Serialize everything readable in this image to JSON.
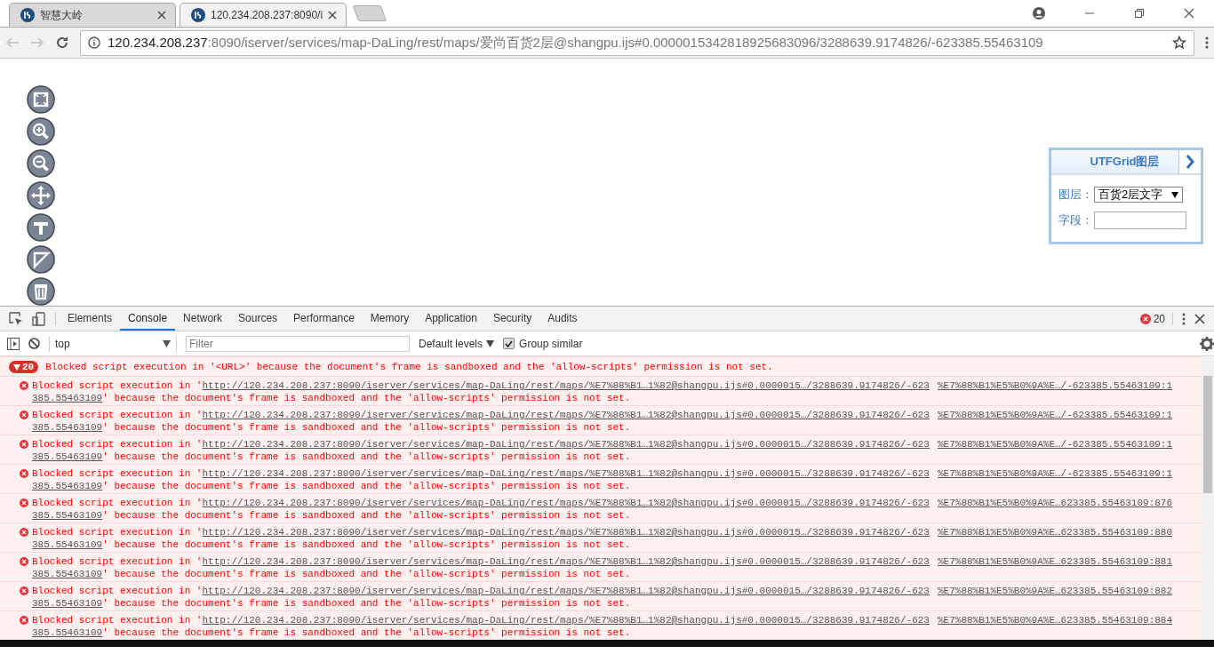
{
  "browser": {
    "tabs": [
      {
        "title": "智慧大岭",
        "selected": false
      },
      {
        "title": "120.234.208.237:8090/i",
        "selected": true
      }
    ],
    "address": {
      "host": "120.234.208.237",
      "path": ":8090/iserver/services/map-DaLing/rest/maps/爱尚百货2层@shangpu.ijs#0.0000015342818925683096/3288639.9174826/-623385.55463109"
    }
  },
  "utfgrid_panel": {
    "title": "UTFGrid图层",
    "fields": [
      {
        "kind": "select",
        "label": "图层：",
        "value": "百货2层文字"
      },
      {
        "kind": "input",
        "label": "字段："
      }
    ]
  },
  "devtools": {
    "tabs": [
      {
        "label": "Elements",
        "selected": false
      },
      {
        "label": "Console",
        "selected": true
      },
      {
        "label": "Network",
        "selected": false
      },
      {
        "label": "Sources",
        "selected": false
      },
      {
        "label": "Performance",
        "selected": false
      },
      {
        "label": "Memory",
        "selected": false
      },
      {
        "label": "Application",
        "selected": false
      },
      {
        "label": "Security",
        "selected": false
      },
      {
        "label": "Audits",
        "selected": false
      }
    ],
    "error_count": "20",
    "context": "top",
    "filter_placeholder": "Filter",
    "levels": "Default levels",
    "group_similar": {
      "label": "Group similar",
      "checked": true
    },
    "group": {
      "count": "20",
      "message": "Blocked script execution in '<URL>' because the document's frame is sandboxed and the 'allow-scripts' permission is not set."
    },
    "messages": [
      {
        "prefix": "Blocked script execution in '",
        "url_line1": "http://120.234.208.237:8090/iserver/services/map-DaLing/rest/maps/%E7%88%B1…1%82@shangpu.ijs#0.0000015…/3288639.9174826/-623",
        "url_line2": "385.55463109",
        "suffix": "' because the document's frame is sandboxed and the 'allow-scripts' permission is not set.",
        "source": "%E7%88%B1%E5%B0%9A%E…/-623385.55463109:1"
      },
      {
        "prefix": "Blocked script execution in '",
        "url_line1": "http://120.234.208.237:8090/iserver/services/map-DaLing/rest/maps/%E7%88%B1…1%82@shangpu.ijs#0.0000015…/3288639.9174826/-623",
        "url_line2": "385.55463109",
        "suffix": "' because the document's frame is sandboxed and the 'allow-scripts' permission is not set.",
        "source": "%E7%88%B1%E5%B0%9A%E…/-623385.55463109:1"
      },
      {
        "prefix": "Blocked script execution in '",
        "url_line1": "http://120.234.208.237:8090/iserver/services/map-DaLing/rest/maps/%E7%88%B1…1%82@shangpu.ijs#0.0000015…/3288639.9174826/-623",
        "url_line2": "385.55463109",
        "suffix": "' because the document's frame is sandboxed and the 'allow-scripts' permission is not set.",
        "source": "%E7%88%B1%E5%B0%9A%E…/-623385.55463109:1"
      },
      {
        "prefix": "Blocked script execution in '",
        "url_line1": "http://120.234.208.237:8090/iserver/services/map-DaLing/rest/maps/%E7%88%B1…1%82@shangpu.ijs#0.0000015…/3288639.9174826/-623",
        "url_line2": "385.55463109",
        "suffix": "' because the document's frame is sandboxed and the 'allow-scripts' permission is not set.",
        "source": "%E7%88%B1%E5%B0%9A%E…/-623385.55463109:1"
      },
      {
        "prefix": "Blocked script execution in '",
        "url_line1": "http://120.234.208.237:8090/iserver/services/map-DaLing/rest/maps/%E7%88%B1…1%82@shangpu.ijs#0.0000015…/3288639.9174826/-623",
        "url_line2": "385.55463109",
        "suffix": "' because the document's frame is sandboxed and the 'allow-scripts' permission is not set.",
        "source": "%E7%88%B1%E5%B0%9A%E…623385.55463109:876"
      },
      {
        "prefix": "Blocked script execution in '",
        "url_line1": "http://120.234.208.237:8090/iserver/services/map-DaLing/rest/maps/%E7%88%B1…1%82@shangpu.ijs#0.0000015…/3288639.9174826/-623",
        "url_line2": "385.55463109",
        "suffix": "' because the document's frame is sandboxed and the 'allow-scripts' permission is not set.",
        "source": "%E7%88%B1%E5%B0%9A%E…623385.55463109:880"
      },
      {
        "prefix": "Blocked script execution in '",
        "url_line1": "http://120.234.208.237:8090/iserver/services/map-DaLing/rest/maps/%E7%88%B1…1%82@shangpu.ijs#0.0000015…/3288639.9174826/-623",
        "url_line2": "385.55463109",
        "suffix": "' because the document's frame is sandboxed and the 'allow-scripts' permission is not set.",
        "source": "%E7%88%B1%E5%B0%9A%E…623385.55463109:881"
      },
      {
        "prefix": "Blocked script execution in '",
        "url_line1": "http://120.234.208.237:8090/iserver/services/map-DaLing/rest/maps/%E7%88%B1…1%82@shangpu.ijs#0.0000015…/3288639.9174826/-623",
        "url_line2": "385.55463109",
        "suffix": "' because the document's frame is sandboxed and the 'allow-scripts' permission is not set.",
        "source": "%E7%88%B1%E5%B0%9A%E…623385.55463109:882"
      },
      {
        "prefix": "Blocked script execution in '",
        "url_line1": "http://120.234.208.237:8090/iserver/services/map-DaLing/rest/maps/%E7%88%B1…1%82@shangpu.ijs#0.0000015…/3288639.9174826/-623",
        "url_line2": "385.55463109",
        "suffix": "' because the document's frame is sandboxed and the 'allow-scripts' permission is not set.",
        "source": "%E7%88%B1%E5%B0%9A%E…623385.55463109:884"
      }
    ]
  }
}
